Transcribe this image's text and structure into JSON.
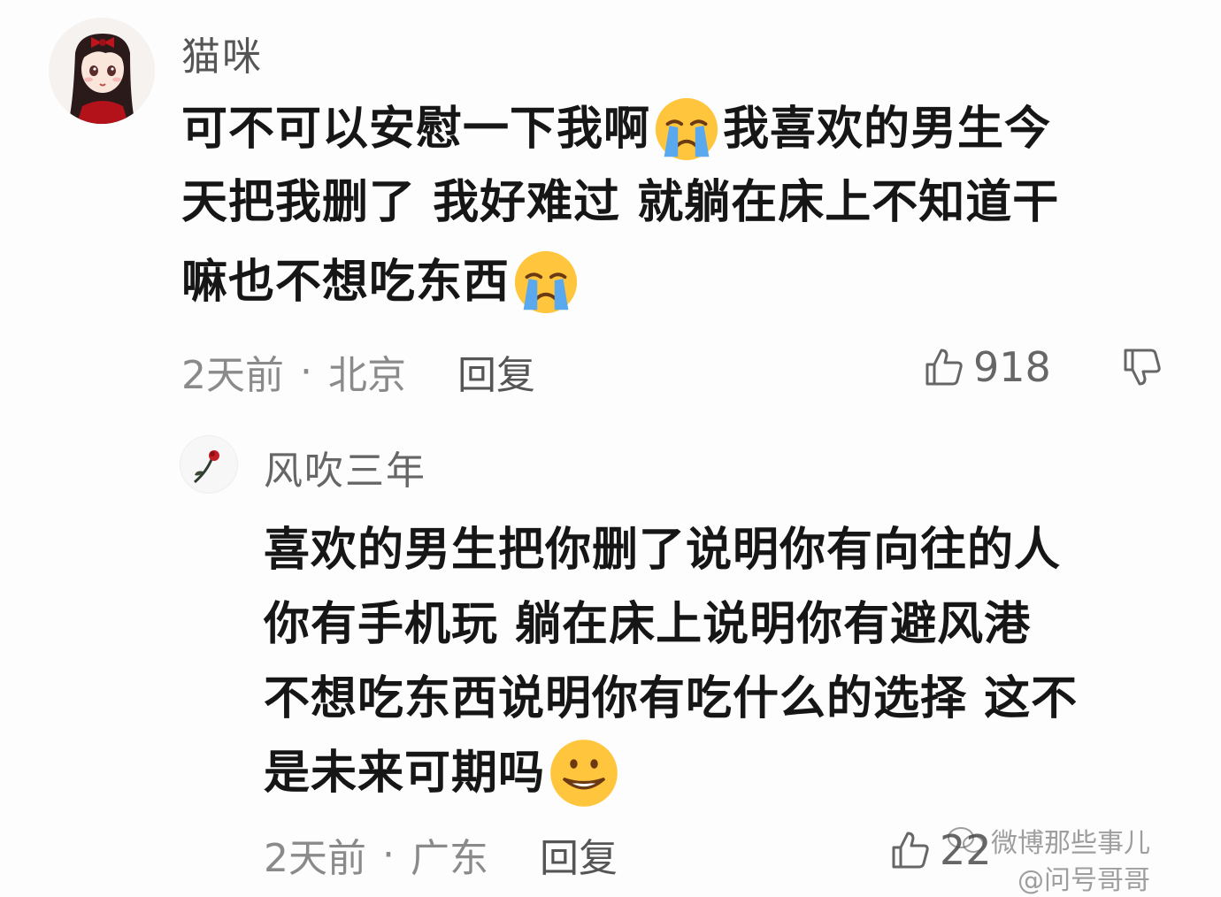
{
  "comment": {
    "username": "猫咪",
    "lines": [
      {
        "before": "可不可以安慰一下我啊",
        "emoji": "crying-emoji",
        "after": "我喜欢的男生今"
      },
      {
        "before": "天把我删了 我好难过 就躺在床上不知道干",
        "emoji": "",
        "after": ""
      },
      {
        "before": "嘛也不想吃东西",
        "emoji": "crying-emoji",
        "after": ""
      }
    ],
    "time": "2天前",
    "dot": "·",
    "location": "北京",
    "reply_label": "回复",
    "like_count": "918",
    "avatar_icon": "girl-avatar-icon"
  },
  "reply": {
    "username": "风吹三年",
    "lines": [
      {
        "before": "喜欢的男生把你删了说明你有向往的人",
        "emoji": "",
        "after": ""
      },
      {
        "before": "你有手机玩  躺在床上说明你有避风港",
        "emoji": "",
        "after": ""
      },
      {
        "before": "不想吃东西说明你有吃什么的选择  这不",
        "emoji": "",
        "after": ""
      },
      {
        "before": "是未来可期吗",
        "emoji": "grin-emoji",
        "after": ""
      }
    ],
    "time": "2天前",
    "dot": "·",
    "location": "广东",
    "reply_label": "回复",
    "like_count_partial": "22",
    "avatar_icon": "rose-avatar-icon"
  },
  "watermark": {
    "line1": "微博那些事儿",
    "line2": "@问号哥哥"
  },
  "colors": {
    "background": "#fdfdfd",
    "text": "#161616",
    "meta": "#8a8a8a"
  }
}
